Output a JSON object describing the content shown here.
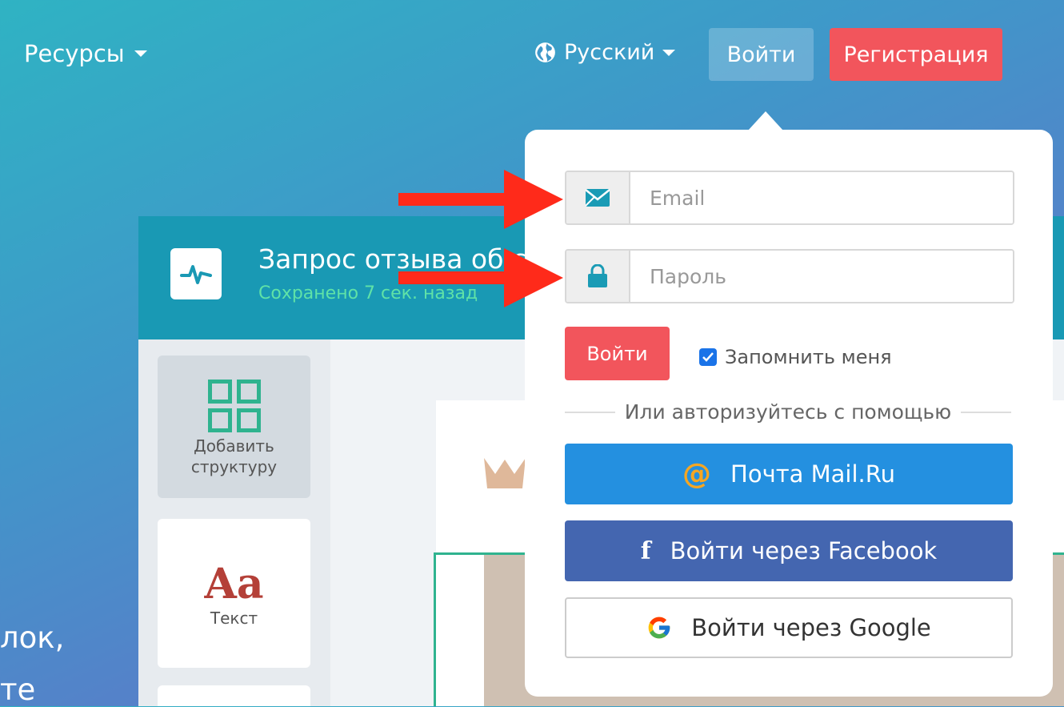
{
  "nav": {
    "resources_label": "Ресурсы",
    "language_label": "Русский",
    "login_label": "Войти",
    "register_label": "Регистрация"
  },
  "hero": {
    "line1": "лок,",
    "line2": "те"
  },
  "editor": {
    "title": "Запрос отзыва об с",
    "saved": "Сохранено 7 сек. назад",
    "tiles": [
      {
        "label": "Добавить\nструктуру"
      },
      {
        "label": "Текст",
        "glyph": "Aa"
      }
    ]
  },
  "login_popup": {
    "email_placeholder": "Email",
    "password_placeholder": "Пароль",
    "submit_label": "Войти",
    "remember_label": "Запомнить меня",
    "remember_checked": true,
    "divider_text": "Или авторизуйтесь с помощью",
    "social": {
      "mailru_label": "Почта Mail.Ru",
      "facebook_label": "Войти через Facebook",
      "google_label": "Войти через Google"
    }
  },
  "colors": {
    "accent_red": "#f2555c",
    "mailru_blue": "#2490e0",
    "facebook_blue": "#4466b0",
    "teal": "#1999b4",
    "annotation_arrow": "#ff2a1a"
  }
}
